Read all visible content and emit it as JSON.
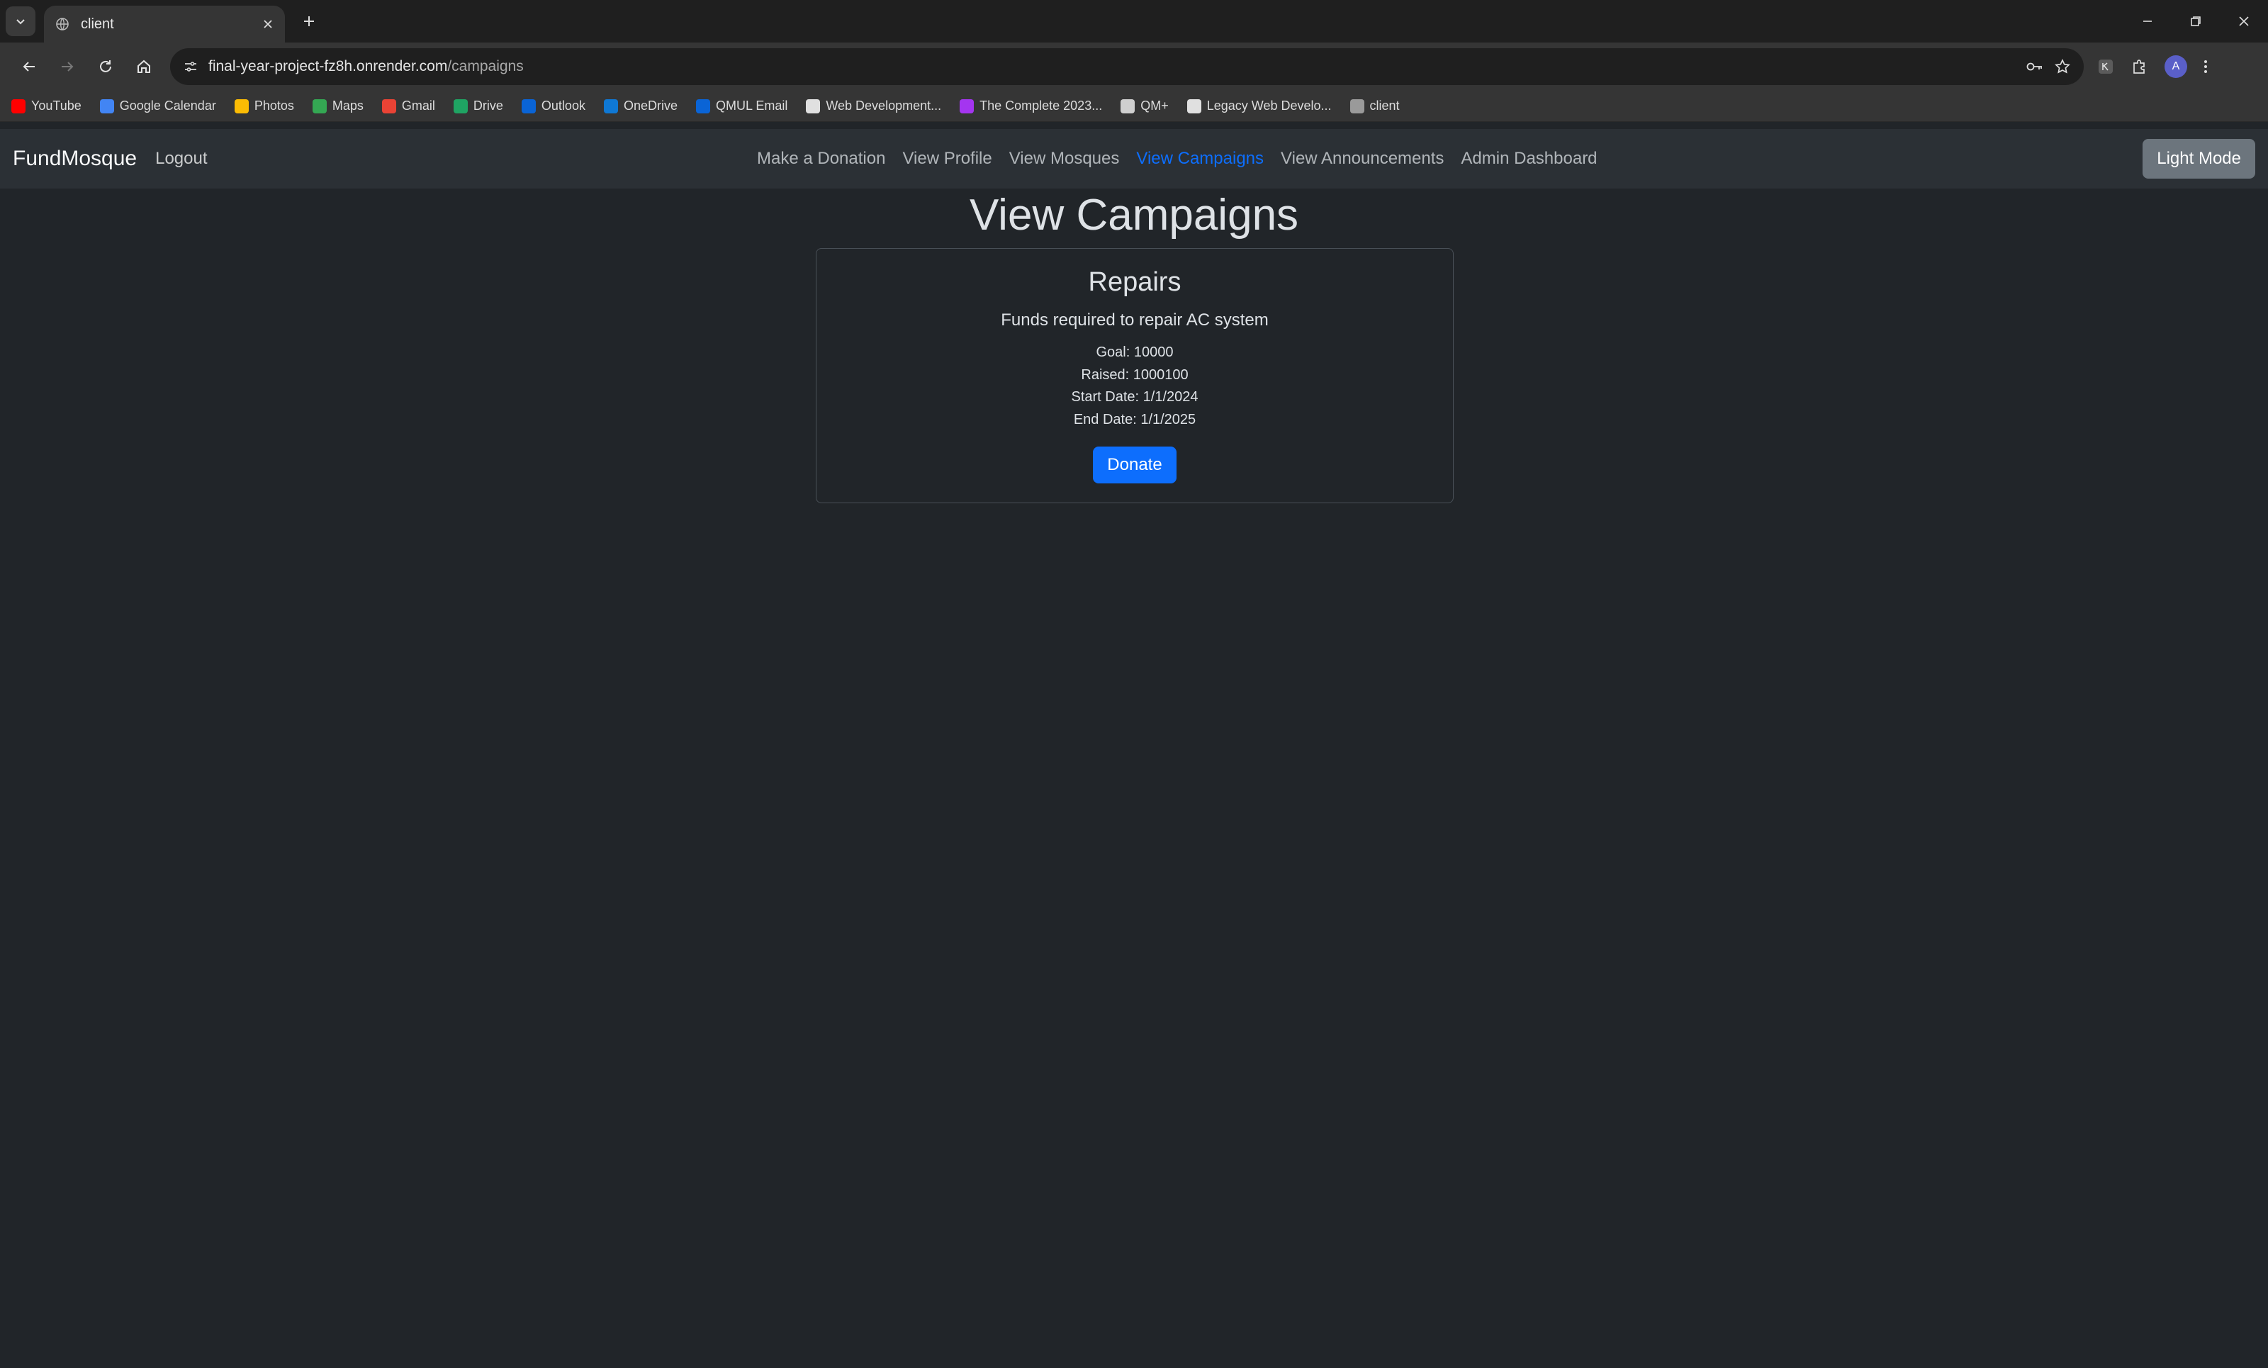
{
  "browser": {
    "tab_title": "client",
    "url_host": "final-year-project-fz8h.onrender.com",
    "url_path": "/campaigns",
    "bookmarks": [
      {
        "label": "YouTube",
        "color": "#ff0000"
      },
      {
        "label": "Google Calendar",
        "color": "#4285f4"
      },
      {
        "label": "Photos",
        "color": "#fbbc04"
      },
      {
        "label": "Maps",
        "color": "#34a853"
      },
      {
        "label": "Gmail",
        "color": "#ea4335"
      },
      {
        "label": "Drive",
        "color": "#1fa463"
      },
      {
        "label": "Outlook",
        "color": "#0a64d6"
      },
      {
        "label": "OneDrive",
        "color": "#0f78d4"
      },
      {
        "label": "QMUL Email",
        "color": "#0a64d6"
      },
      {
        "label": "Web Development...",
        "color": "#e0e0e0"
      },
      {
        "label": "The Complete 2023...",
        "color": "#a435f0"
      },
      {
        "label": "QM+",
        "color": "#cfcfcf"
      },
      {
        "label": "Legacy Web Develo...",
        "color": "#e0e0e0"
      },
      {
        "label": "client",
        "color": "#9a9a9a"
      }
    ]
  },
  "navbar": {
    "brand": "FundMosque",
    "logout": "Logout",
    "links": [
      "Make a Donation",
      "View Profile",
      "View Mosques",
      "View Campaigns",
      "View Announcements",
      "Admin Dashboard"
    ],
    "active_link": "View Campaigns",
    "mode_button": "Light Mode"
  },
  "page": {
    "title": "View Campaigns"
  },
  "campaign": {
    "name": "Repairs",
    "description": "Funds required to repair AC system",
    "goal": "Goal: 10000",
    "raised": "Raised: 1000100",
    "start_date": "Start Date: 1/1/2024",
    "end_date": "End Date: 1/1/2025",
    "donate_label": "Donate"
  },
  "colors": {
    "page_bg": "#212529",
    "navbar_bg": "#2b3035",
    "primary": "#0d6efd",
    "secondary": "#6c757d"
  }
}
